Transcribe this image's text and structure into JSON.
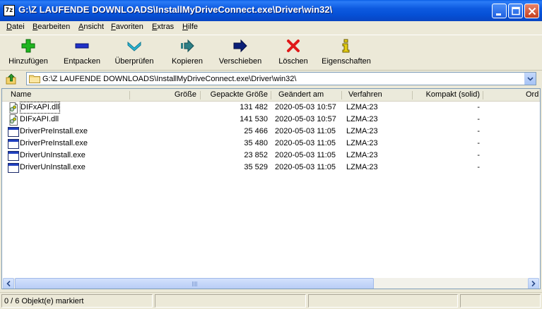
{
  "window": {
    "title": "G:\\Z LAUFENDE DOWNLOADS\\InstallMyDriveConnect.exe\\Driver\\win32\\",
    "app_icon_label": "7z"
  },
  "menu": [
    {
      "label": "Datei",
      "mnemonic": "D",
      "rest": "atei"
    },
    {
      "label": "Bearbeiten",
      "mnemonic": "B",
      "rest": "earbeiten"
    },
    {
      "label": "Ansicht",
      "mnemonic": "A",
      "rest": "nsicht"
    },
    {
      "label": "Favoriten",
      "mnemonic": "F",
      "rest": "avoriten"
    },
    {
      "label": "Extras",
      "mnemonic": "E",
      "rest": "xtras"
    },
    {
      "label": "Hilfe",
      "mnemonic": "H",
      "rest": "ilfe"
    }
  ],
  "toolbar": {
    "add": {
      "label": "Hinzufügen",
      "icon": "plus-icon",
      "color": "#1fb51f"
    },
    "extract": {
      "label": "Entpacken",
      "icon": "minus-icon",
      "color": "#1f30c8"
    },
    "test": {
      "label": "Überprüfen",
      "icon": "check-chevron-icon",
      "color": "#2ab5d4"
    },
    "copy": {
      "label": "Kopieren",
      "icon": "copy-arrow-icon",
      "color": "#2d7f86"
    },
    "move": {
      "label": "Verschieben",
      "icon": "move-arrow-icon",
      "color": "#0a1f78"
    },
    "delete": {
      "label": "Löschen",
      "icon": "x-icon",
      "color": "#e01818"
    },
    "info": {
      "label": "Eigenschaften",
      "icon": "info-icon",
      "color": "#e3cc12"
    }
  },
  "address": {
    "path": "G:\\Z LAUFENDE DOWNLOADS\\InstallMyDriveConnect.exe\\Driver\\win32\\"
  },
  "columns": {
    "name": "Name",
    "size": "Größe",
    "packed": "Gepackte Größe",
    "modified": "Geändert am",
    "method": "Verfahren",
    "solid": "Kompakt (solid)",
    "order": "Ord"
  },
  "files": [
    {
      "name": "DIFxAPI.dll",
      "type": "dll",
      "size": "",
      "packed": "131 482",
      "modified": "2020-05-03 10:57",
      "method": "LZMA:23",
      "solid": "-"
    },
    {
      "name": "DIFxAPI.dll",
      "type": "dll",
      "size": "",
      "packed": "141 530",
      "modified": "2020-05-03 10:57",
      "method": "LZMA:23",
      "solid": "-"
    },
    {
      "name": "DriverPreInstall.exe",
      "type": "exe",
      "size": "",
      "packed": "25 466",
      "modified": "2020-05-03 11:05",
      "method": "LZMA:23",
      "solid": "-"
    },
    {
      "name": "DriverPreInstall.exe",
      "type": "exe",
      "size": "",
      "packed": "35 480",
      "modified": "2020-05-03 11:05",
      "method": "LZMA:23",
      "solid": "-"
    },
    {
      "name": "DriverUnInstall.exe",
      "type": "exe",
      "size": "",
      "packed": "23 852",
      "modified": "2020-05-03 11:05",
      "method": "LZMA:23",
      "solid": "-"
    },
    {
      "name": "DriverUnInstall.exe",
      "type": "exe",
      "size": "",
      "packed": "35 529",
      "modified": "2020-05-03 11:05",
      "method": "LZMA:23",
      "solid": "-"
    }
  ],
  "status": {
    "selection": "0 / 6 Objekt(e) markiert"
  }
}
